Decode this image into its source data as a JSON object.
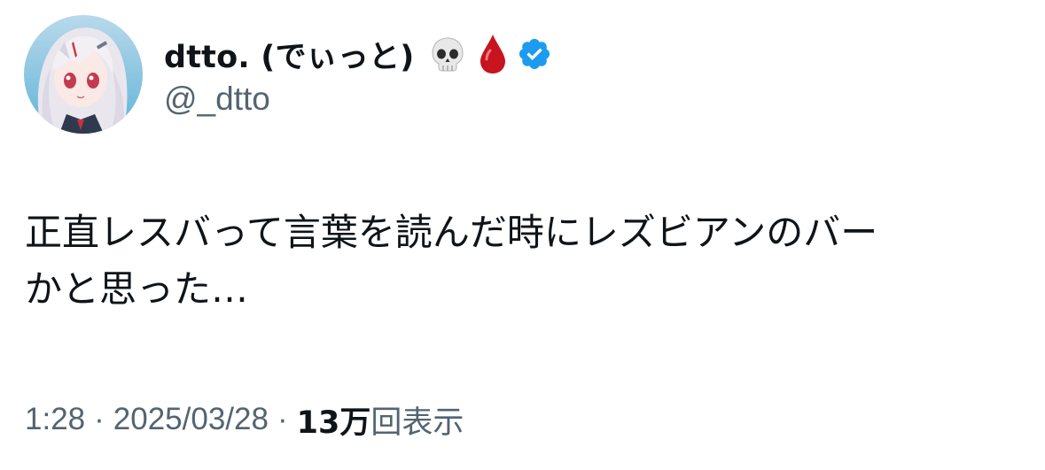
{
  "author": {
    "display_name": "dtto. (でぃっと)",
    "handle": "@_dtto",
    "name_emojis": [
      "skull-icon",
      "drop-of-blood-icon"
    ],
    "verified": true
  },
  "tweet": {
    "text_line1": "正直レスバって言葉を読んだ時にレズビアンのバー",
    "text_line2": "かと思った…"
  },
  "meta": {
    "time": "1:28",
    "separator": "·",
    "date": "2025/03/28",
    "views_count": "13万",
    "views_label": "回表示"
  },
  "colors": {
    "text_primary": "#0f1419",
    "text_secondary": "#536471",
    "verified_badge": "#1d9bf0",
    "background": "#ffffff"
  }
}
